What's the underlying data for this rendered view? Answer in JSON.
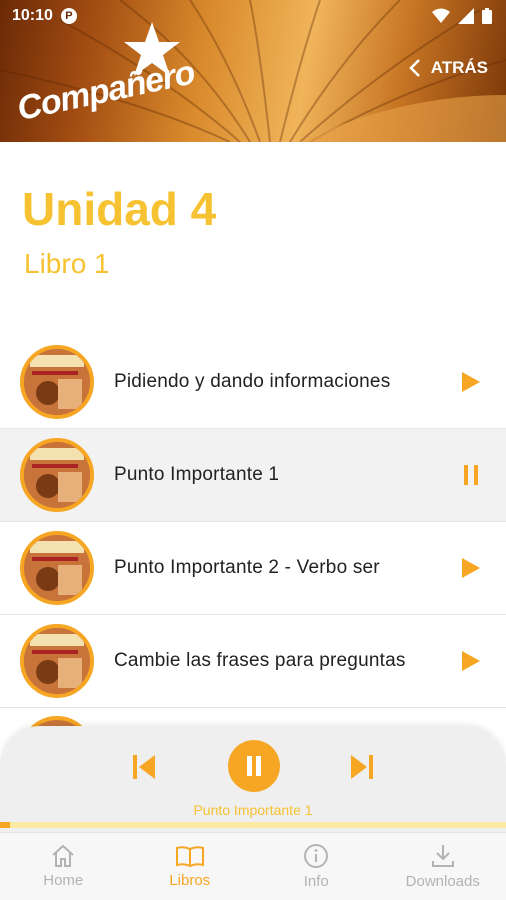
{
  "status_bar": {
    "time": "10:10",
    "notification_icon": "app-notification-icon"
  },
  "header": {
    "logo_text": "Compañero",
    "back_label": "ATRÁS"
  },
  "unit": {
    "title": "Unidad 4",
    "subtitle": "Libro 1"
  },
  "tracks": [
    {
      "title": "Pidiendo y dando informaciones",
      "state": "play"
    },
    {
      "title": "Punto Importante 1",
      "state": "pause"
    },
    {
      "title": "Punto Importante 2 - Verbo ser",
      "state": "play"
    },
    {
      "title": "Cambie las frases para preguntas",
      "state": "play"
    }
  ],
  "player": {
    "now_playing": "Punto Importante 1",
    "progress_fraction": 0.02,
    "icons": [
      "skip-previous-icon",
      "pause-icon",
      "skip-next-icon"
    ]
  },
  "nav": {
    "items": [
      {
        "label": "Home",
        "icon": "home-icon"
      },
      {
        "label": "Libros",
        "icon": "book-icon",
        "active": true
      },
      {
        "label": "Info",
        "icon": "info-icon"
      },
      {
        "label": "Downloads",
        "icon": "download-icon"
      }
    ]
  },
  "colors": {
    "accent": "#f6a623",
    "title_yellow": "#f6c232",
    "inactive": "#b3b3b3"
  }
}
